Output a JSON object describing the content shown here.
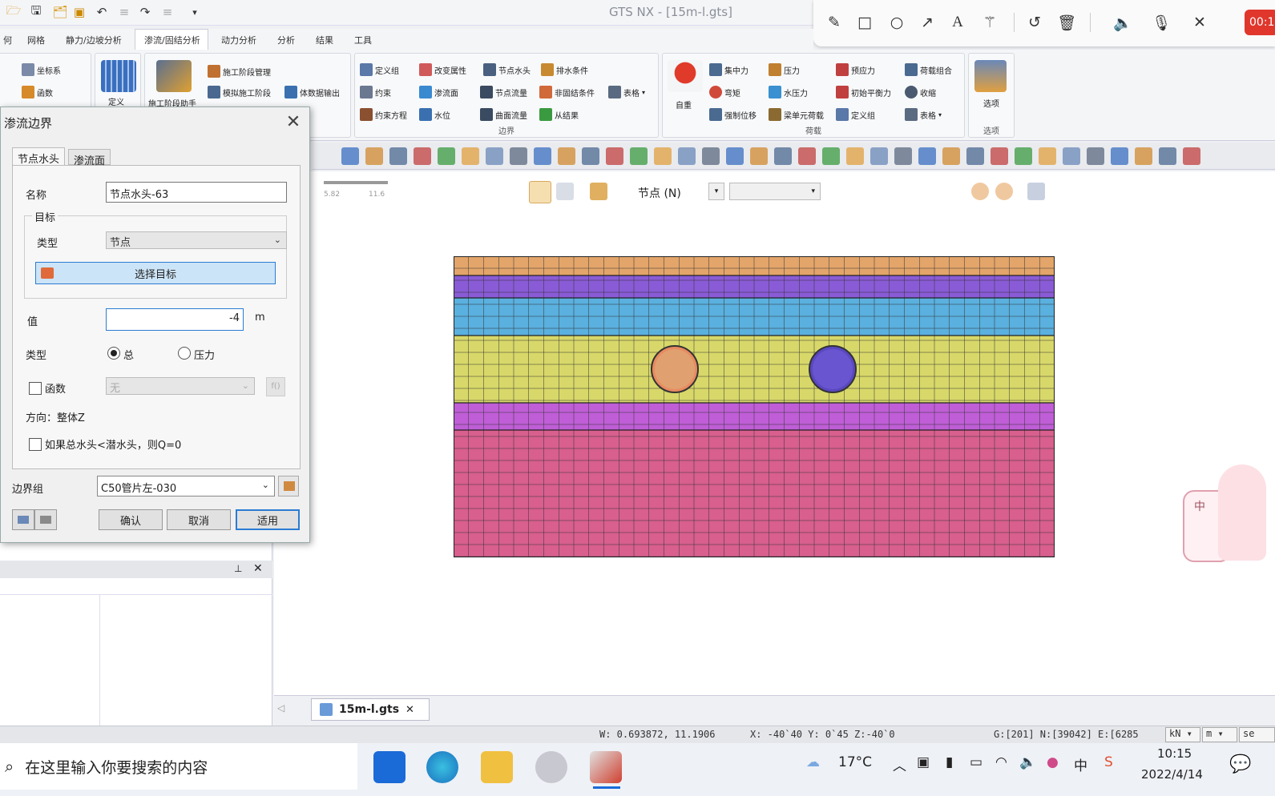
{
  "app": {
    "title": "GTS NX - [15m-l.gts]"
  },
  "annotation_toolbar": {
    "tools": [
      "pencil-icon",
      "rectangle-icon",
      "circle-icon",
      "arrow-icon",
      "text-icon",
      "magic-wand-icon",
      "undo-icon",
      "delete-icon",
      "speaker-icon",
      "microphone-icon",
      "close-icon"
    ],
    "timer": "00:1"
  },
  "menu": {
    "items": [
      "何",
      "网格",
      "静力/边坡分析",
      "渗流/固结分析",
      "动力分析",
      "分析",
      "结果",
      "工具"
    ],
    "active": "渗流/固结分析"
  },
  "ribbon": {
    "g1": {
      "items": [
        "坐标系",
        "函数"
      ]
    },
    "g2": {
      "label": "定义"
    },
    "g3": {
      "big": "施工阶段助手",
      "items": [
        "施工阶段管理",
        "模拟施工阶段",
        "体数据输出"
      ]
    },
    "boundary": {
      "title": "边界",
      "items": [
        "定义组",
        "改变属性",
        "节点水头",
        "排水条件",
        "约束",
        "渗流面",
        "节点流量",
        "非固结条件",
        "表格",
        "约束方程",
        "水位",
        "曲面流量",
        "从结果"
      ]
    },
    "load": {
      "title": "荷载",
      "big": "自重",
      "items": [
        "集中力",
        "压力",
        "预应力",
        "荷载组合",
        "弯矩",
        "水压力",
        "初始平衡力",
        "收缩",
        "强制位移",
        "梁单元荷载",
        "定义组",
        "表格"
      ]
    },
    "options": {
      "title": "选项",
      "label": "选项"
    }
  },
  "toolbar2": {
    "select_label": "节点 (N)"
  },
  "ruler": {
    "a": "5.82",
    "b": "11.6"
  },
  "dialog": {
    "title": "渗流边界",
    "tabs": [
      "节点水头",
      "渗流面"
    ],
    "name_label": "名称",
    "name_value": "节点水头-63",
    "target_group": "目标",
    "type_label": "类型",
    "type_value": "节点",
    "select_target": "选择目标",
    "value_label": "值",
    "value": "-4",
    "unit": "m",
    "kind_label": "类型",
    "kind_total": "总",
    "kind_pressure": "压力",
    "func_label": "函数",
    "func_value": "无",
    "direction": "方向：整体Z",
    "condition": "如果总水头<潜水头，则Q=0",
    "group_label": "边界组",
    "group_value": "C50管片左-030",
    "ok": "确认",
    "cancel": "取消",
    "apply": "适用"
  },
  "file_tab": {
    "name": "15m-l.gts"
  },
  "status": {
    "coords": "W: 0.693872, 11.1906",
    "view": "X: -40`40 Y: 0`45 Z:-40`0",
    "counts": "G:[201] N:[39042] E:[6285",
    "unit1": "kN",
    "unit2": "m",
    "unit3": "se"
  },
  "taskbar": {
    "search_placeholder": "在这里输入你要搜索的内容",
    "weather": "17°C",
    "ime": "中",
    "time": "10:15",
    "date": "2022/4/14"
  },
  "mesh_colors": {
    "top": "#e3a56a",
    "purple": "#8a5bd6",
    "blue": "#5ab0de",
    "yellow": "#d8d86a",
    "violet": "#bf5ed6",
    "pink": "#d85f8e",
    "tunnel_left": "#e0a070",
    "tunnel_right": "#6a55d0"
  },
  "sticker": {
    "text": "中"
  }
}
